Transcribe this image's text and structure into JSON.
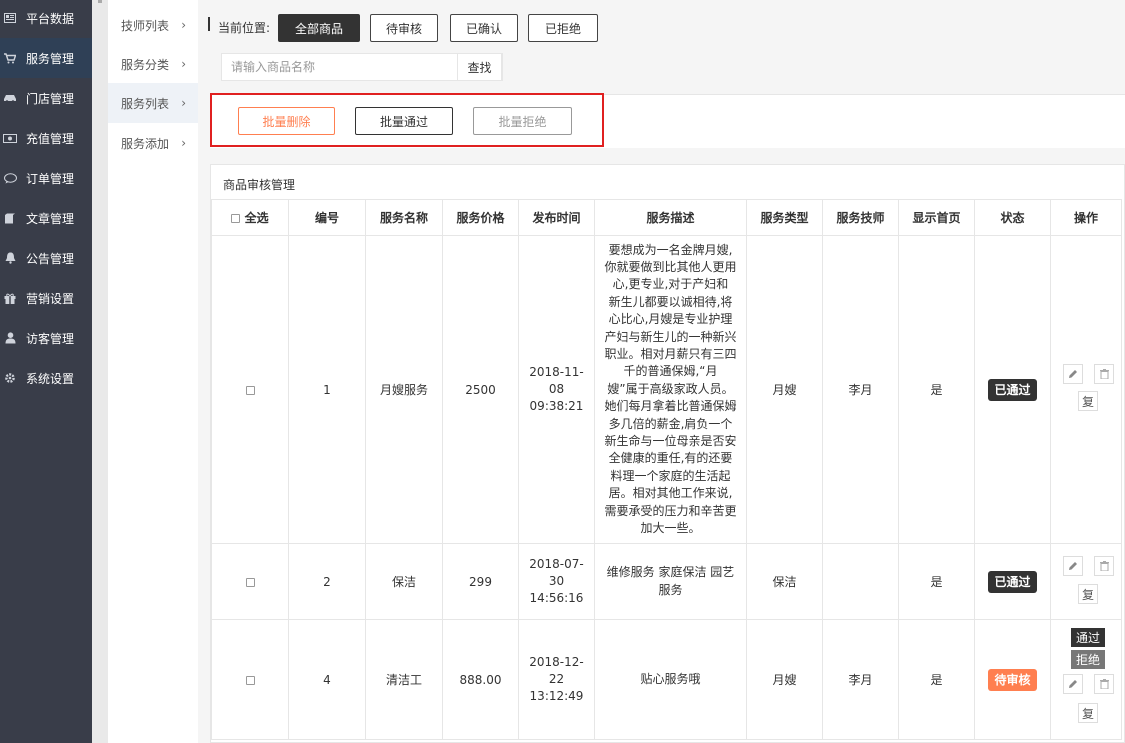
{
  "sidebar": {
    "items": [
      {
        "label": "平台数据",
        "icon": "dashboard-icon"
      },
      {
        "label": "服务管理",
        "icon": "cart-icon"
      },
      {
        "label": "门店管理",
        "icon": "car-icon"
      },
      {
        "label": "充值管理",
        "icon": "money-icon"
      },
      {
        "label": "订单管理",
        "icon": "comment-icon"
      },
      {
        "label": "文章管理",
        "icon": "book-icon"
      },
      {
        "label": "公告管理",
        "icon": "bell-icon"
      },
      {
        "label": "营销设置",
        "icon": "gift-icon"
      },
      {
        "label": "访客管理",
        "icon": "user-icon"
      },
      {
        "label": "系统设置",
        "icon": "cog-icon"
      }
    ],
    "active_index": 1
  },
  "submenu": {
    "items": [
      {
        "label": "技师列表",
        "arrow": "›"
      },
      {
        "label": "服务分类",
        "arrow": "›"
      },
      {
        "label": "服务列表",
        "arrow": "›"
      },
      {
        "label": "服务添加",
        "arrow": "›"
      }
    ],
    "active_index": 2
  },
  "breadcrumb": {
    "label": "当前位置:",
    "tabs": [
      "全部商品",
      "待审核",
      "已确认",
      "已拒绝"
    ],
    "active_index": 0
  },
  "search": {
    "placeholder": "请输入商品名称",
    "value": "",
    "button": "查找"
  },
  "batch": {
    "delete": "批量删除",
    "pass": "批量通过",
    "reject": "批量拒绝"
  },
  "table": {
    "title": "商品审核管理",
    "select_all": "全选",
    "columns": [
      "编号",
      "服务名称",
      "服务价格",
      "发布时间",
      "服务描述",
      "服务类型",
      "服务技师",
      "显示首页",
      "状态",
      "操作"
    ],
    "rows": [
      {
        "id": "1",
        "name": "月嫂服务",
        "price": "2500",
        "time_lines": [
          "2018-11-",
          "08",
          "09:38:21"
        ],
        "desc_lines": [
          "要想成为一名金牌月嫂,",
          "你就要做到比其他人更用",
          "心,更专业,对于产妇和",
          "新生儿都要以诚相待,将",
          "心比心,月嫂是专业护理",
          "产妇与新生儿的一种新兴",
          "职业。相对月薪只有三四",
          "千的普通保姆,“月",
          "嫂”属于高级家政人员。",
          "她们每月拿着比普通保姆",
          "多几倍的薪金,肩负一个",
          "新生命与一位母亲是否安",
          "全健康的重任,有的还要",
          "料理一个家庭的生活起",
          "居。相对其他工作来说,",
          "需要承受的压力和辛苦更",
          "加大一些。"
        ],
        "type": "月嫂",
        "tech": "李月",
        "home": "是",
        "status": "已通过",
        "status_kind": "ok",
        "op_restore": "复"
      },
      {
        "id": "2",
        "name": "保洁",
        "price": "299",
        "time_lines": [
          "2018-07-",
          "30",
          "14:56:16"
        ],
        "desc_lines": [
          "维修服务 家庭保洁 园艺",
          "服务"
        ],
        "type": "保洁",
        "tech": "",
        "home": "是",
        "status": "已通过",
        "status_kind": "ok",
        "op_restore": "复"
      },
      {
        "id": "4",
        "name": "清洁工",
        "price": "888.00",
        "time_lines": [
          "2018-12-",
          "22",
          "13:12:49"
        ],
        "desc_lines": [
          "贴心服务哦"
        ],
        "type": "月嫂",
        "tech": "李月",
        "home": "是",
        "status": "待审核",
        "status_kind": "wait",
        "op_pass": "通过",
        "op_reject": "拒绝",
        "op_restore": "复"
      }
    ]
  },
  "colors": {
    "sidebar_bg": "#393d49",
    "sidebar_active": "#2f4056",
    "accent_orange": "#ff7f50",
    "dark": "#333333",
    "highlight_red": "#e02020"
  }
}
